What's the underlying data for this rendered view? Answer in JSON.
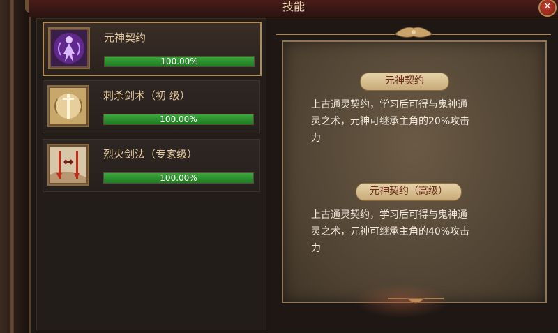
{
  "window": {
    "title": "技能",
    "close_icon": "close-icon"
  },
  "skills": [
    {
      "name": "元神契约",
      "progress_label": "100.00%",
      "progress": 1.0,
      "icon": "spirit-figure-icon",
      "selected": true
    },
    {
      "name": "刺杀剑术（初 级）",
      "progress_label": "100.00%",
      "progress": 1.0,
      "icon": "sword-slash-icon",
      "selected": false
    },
    {
      "name": "烈火剑法（专家级）",
      "progress_label": "100.00%",
      "progress": 1.0,
      "icon": "flame-sword-icon",
      "selected": false
    }
  ],
  "detail": {
    "sections": [
      {
        "title": "元神契约",
        "lines": [
          "上古通灵契约，学习后可得与鬼神通",
          "灵之术，元神可继承主角的20%攻击",
          "力"
        ]
      },
      {
        "title": "元神契约（高级）",
        "lines": [
          "上古通灵契约，学习后可得与鬼神通",
          "灵之术，元神可继承主角的40%攻击",
          "力"
        ]
      }
    ]
  },
  "colors": {
    "progress_fill": "#2f9a32",
    "title_text": "#e8d4b0",
    "skill_name": "#e2c89c",
    "section_title_text": "#6a2a1a"
  }
}
